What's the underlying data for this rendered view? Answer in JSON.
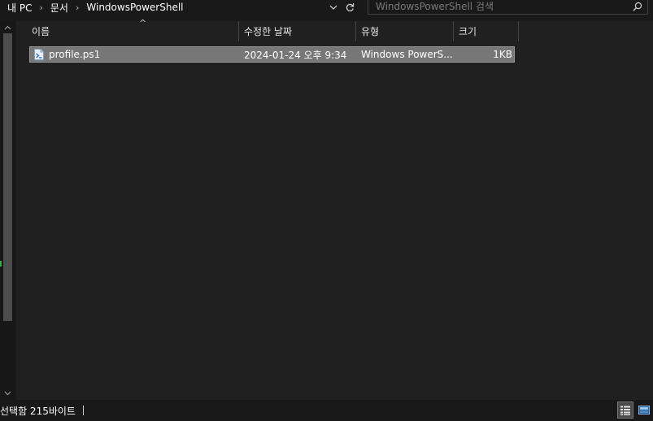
{
  "breadcrumb": {
    "items": [
      "내 PC",
      "문서",
      "WindowsPowerShell"
    ],
    "separator": "›"
  },
  "search": {
    "placeholder": "WindowsPowerShell 검색",
    "value": ""
  },
  "columns": {
    "name": "이름",
    "modified": "수정한 날짜",
    "type": "유형",
    "size": "크기"
  },
  "files": [
    {
      "name": "profile.ps1",
      "modified": "2024-01-24 오후 9:34",
      "type": "Windows PowerS...",
      "size": "1KB",
      "selected": true
    }
  ],
  "status": {
    "text": "선택함 215바이트"
  },
  "colors": {
    "background": "#202020",
    "selection": "#777777",
    "text": "#ffffff"
  },
  "icons": {
    "dropdown": "chevron-down-icon",
    "refresh": "refresh-icon",
    "search": "search-icon",
    "sort": "sort-ascending-icon",
    "file": "powershell-script-icon",
    "details_view": "details-view-icon",
    "tiles_view": "large-icons-view-icon"
  }
}
